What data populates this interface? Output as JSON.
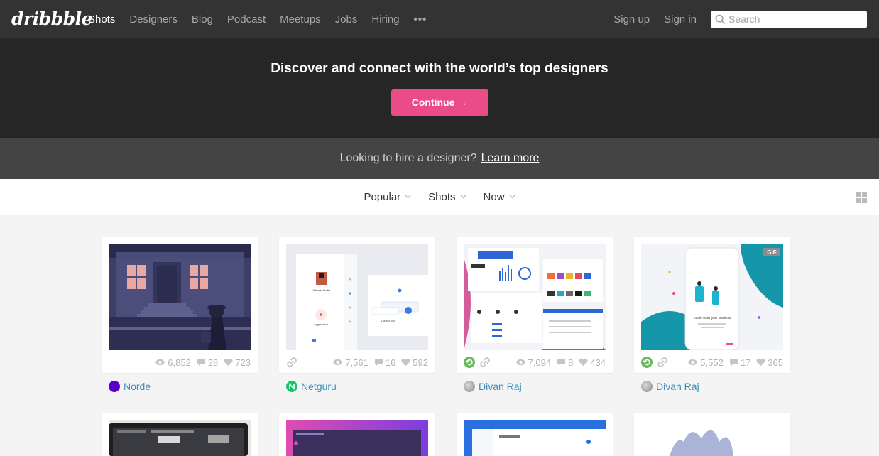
{
  "nav": {
    "logo": "dribbble",
    "items": [
      "Shots",
      "Designers",
      "Blog",
      "Podcast",
      "Meetups",
      "Jobs",
      "Hiring"
    ],
    "more": "•••",
    "sign_up": "Sign up",
    "sign_in": "Sign in",
    "search_placeholder": "Search"
  },
  "hero": {
    "title": "Discover and connect with the world’s top designers",
    "cta": "Continue →"
  },
  "hire": {
    "text": "Looking to hire a designer?",
    "link": "Learn more"
  },
  "filters": [
    "Popular",
    "Shots",
    "Now"
  ],
  "colors": {
    "accent": "#ea4c89",
    "link": "#3a8bbb"
  },
  "shots": [
    {
      "views": "6,852",
      "comments": "28",
      "likes": "723",
      "author": "Norde",
      "avatar_color": "#5a00c8",
      "link_icon": false,
      "rebound_icon": false,
      "gif": false
    },
    {
      "views": "7,561",
      "comments": "16",
      "likes": "592",
      "author": "Netguru",
      "avatar_color": "#19c46a",
      "link_icon": true,
      "rebound_icon": false,
      "gif": false
    },
    {
      "views": "7,094",
      "comments": "8",
      "likes": "434",
      "author": "Divan Raj",
      "avatar_color": "#9a9a9a",
      "link_icon": true,
      "rebound_icon": true,
      "gif": false
    },
    {
      "views": "5,552",
      "comments": "17",
      "likes": "365",
      "author": "Divan Raj",
      "avatar_color": "#9a9a9a",
      "link_icon": true,
      "rebound_icon": true,
      "gif": true,
      "gif_label": "GIF"
    }
  ],
  "thumb2": {
    "name": "Warner Duffet",
    "sub": "Aggression",
    "label": "Distribution"
  },
  "thumb4": {
    "headline": "Easily order your products"
  }
}
